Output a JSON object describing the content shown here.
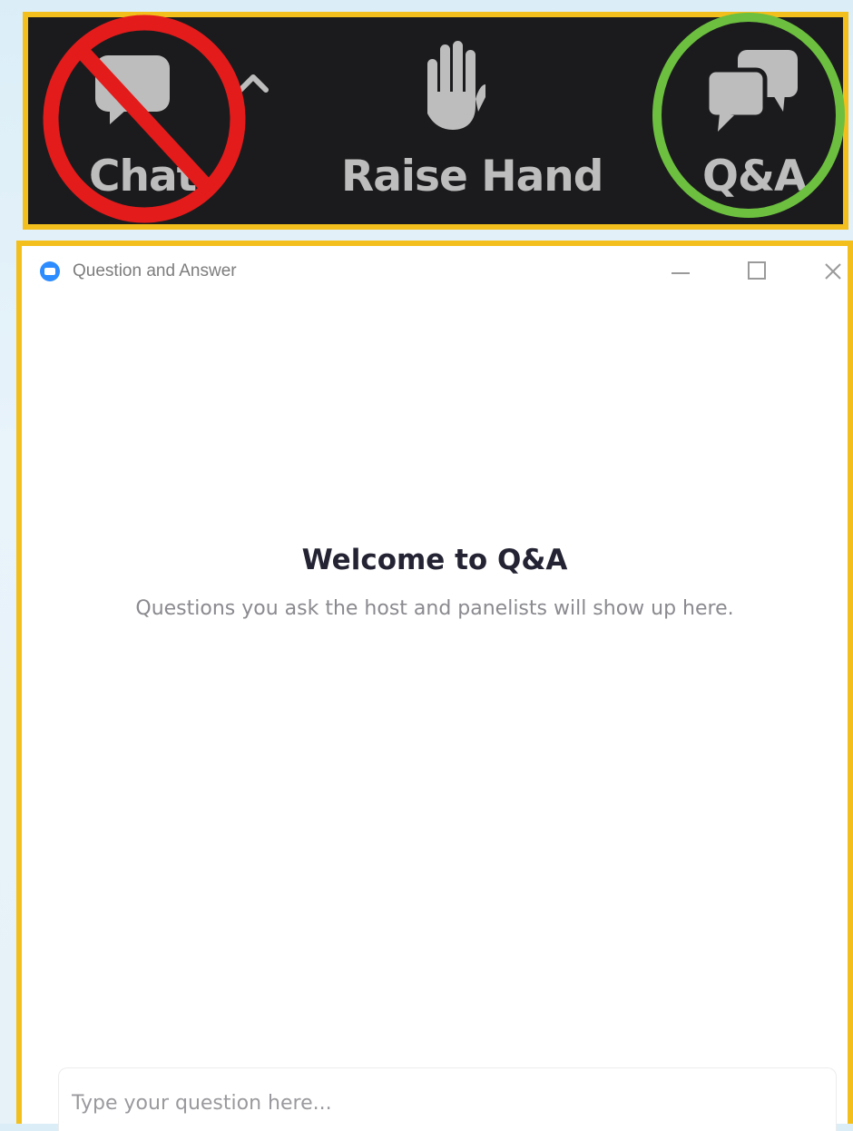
{
  "toolbar": {
    "chat": {
      "label": "Chat",
      "icon": "chat-bubble-icon",
      "caret_icon": "caret-up-icon",
      "overlay": "prohibited-circle-icon",
      "overlay_color": "#e31b1b"
    },
    "raise_hand": {
      "label": "Raise Hand",
      "icon": "hand-icon"
    },
    "qa": {
      "label": "Q&A",
      "icon": "qa-bubbles-icon",
      "overlay": "highlight-circle-icon",
      "overlay_color": "#6cbf3f"
    },
    "highlight_border_color": "#f3bf1c"
  },
  "window": {
    "title": "Question and Answer",
    "app_icon": "zoom-logo-icon",
    "controls": [
      "minimize-icon",
      "maximize-icon",
      "close-icon"
    ],
    "welcome_title": "Welcome to Q&A",
    "welcome_subtitle": "Questions you ask the host and panelists will show up here.",
    "input_placeholder": "Type your question here..."
  }
}
